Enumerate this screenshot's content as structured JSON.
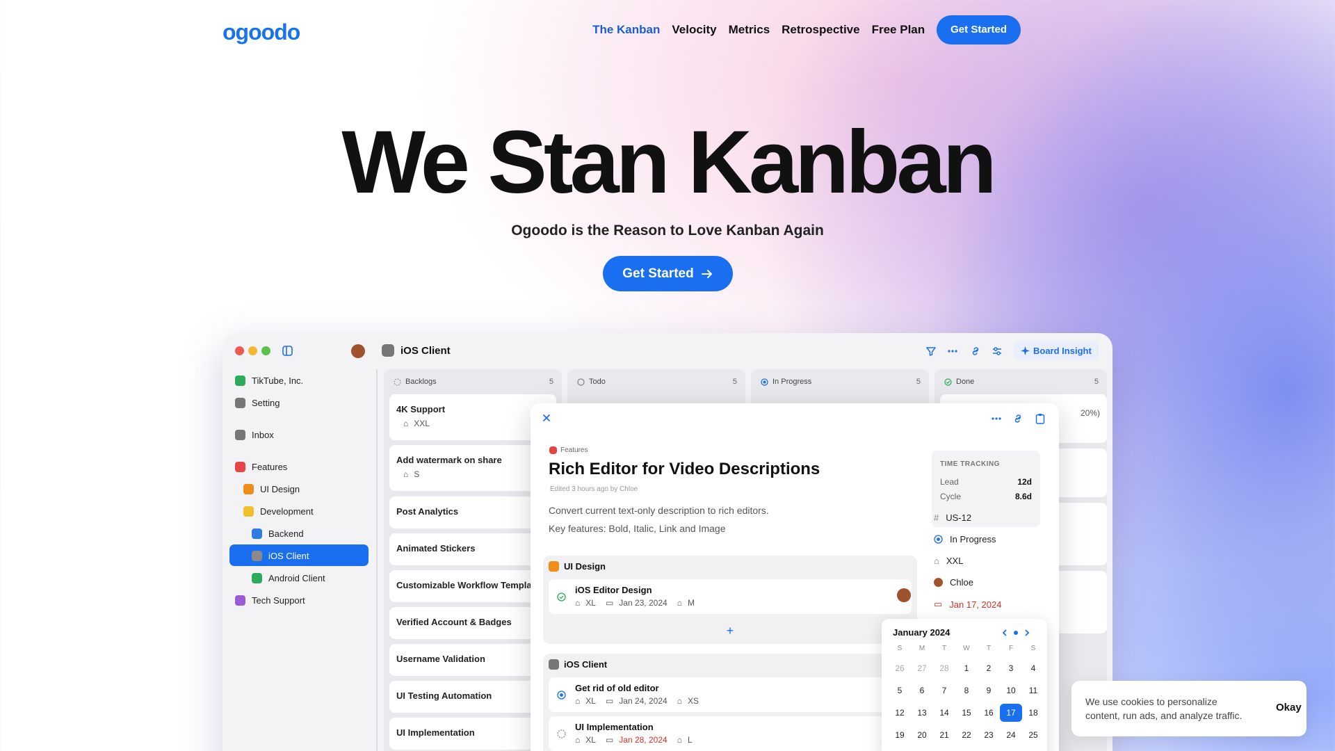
{
  "brand": {
    "logo": "ogoodo"
  },
  "nav": {
    "links": [
      "The Kanban",
      "Velocity",
      "Metrics",
      "Retrospective",
      "Free Plan"
    ],
    "cta": "Get Started"
  },
  "hero": {
    "title": "We Stan Kanban",
    "subtitle": "Ogoodo is the Reason to Love Kanban Again",
    "cta": "Get Started"
  },
  "app": {
    "title": "iOS Client",
    "board_insight": "Board Insight",
    "sidebar": {
      "items": [
        "TikTube, Inc.",
        "Setting",
        "Inbox",
        "Features",
        "UI Design",
        "Development",
        "Backend",
        "iOS Client",
        "Android Client",
        "Tech Support"
      ]
    },
    "columns": [
      {
        "name": "Backlogs",
        "count": "5"
      },
      {
        "name": "Todo",
        "count": "5"
      },
      {
        "name": "In Progress",
        "count": "5"
      },
      {
        "name": "Done",
        "count": "5"
      }
    ],
    "backlog_cards": [
      {
        "title": "4K Support",
        "size": "XXL"
      },
      {
        "title": "Add watermark on share",
        "size": "S"
      },
      {
        "title": "Post Analytics"
      },
      {
        "title": "Animated Stickers"
      },
      {
        "title": "Customizable Workflow Templa"
      },
      {
        "title": "Verified Account & Badges"
      },
      {
        "title": "Username Validation"
      },
      {
        "title": "UI Testing Automation"
      },
      {
        "title": "UI Implementation"
      }
    ],
    "done_partial": "20%)"
  },
  "modal": {
    "category": "Features",
    "title": "Rich Editor for Video Descriptions",
    "edited": "Edited 3 hours ago by Chloe",
    "description": [
      "Convert current text-only description to rich editors.",
      "Key features: Bold, Italic, Link and Image"
    ],
    "sections": [
      {
        "name": "UI Design",
        "tasks": [
          {
            "title": "iOS Editor Design",
            "size": "XL",
            "date": "Jan 23, 2024",
            "tag": "M"
          }
        ]
      },
      {
        "name": "iOS Client",
        "tasks": [
          {
            "title": "Get rid of old editor",
            "size": "XL",
            "date": "Jan 24, 2024",
            "tag": "XS"
          },
          {
            "title": "UI Implementation",
            "size": "XL",
            "date": "Jan 28, 2024",
            "tag": "L"
          }
        ]
      }
    ],
    "add_symbol": "+",
    "time_tracking": {
      "label": "TIME TRACKING",
      "lead_label": "Lead",
      "lead": "12d",
      "cycle_label": "Cycle",
      "cycle": "8.6d"
    },
    "details": {
      "id": "US-12",
      "status": "In Progress",
      "size": "XXL",
      "assignee": "Chloe",
      "due": "Jan 17, 2024"
    }
  },
  "calendar": {
    "month": "January 2024",
    "dow": [
      "S",
      "M",
      "T",
      "W",
      "T",
      "F",
      "S"
    ],
    "days": [
      "26",
      "27",
      "28",
      "1",
      "2",
      "3",
      "4",
      "5",
      "6",
      "7",
      "8",
      "9",
      "10",
      "11",
      "12",
      "13",
      "14",
      "15",
      "16",
      "17",
      "18",
      "19",
      "20",
      "21",
      "22",
      "23",
      "24",
      "25"
    ],
    "selected": "17"
  },
  "cookie": {
    "text": "We use cookies to personalize content, run ads, and analyze traffic.",
    "button": "Okay"
  },
  "colors": {
    "accent": "#1a6ff0",
    "danger": "#d93025",
    "success": "#2eaa5c"
  }
}
